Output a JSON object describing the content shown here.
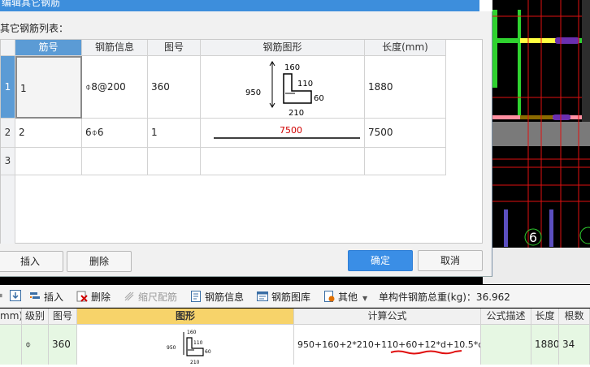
{
  "dialog": {
    "title": "编辑其它钢筋",
    "list_label": "其它钢筋列表：",
    "columns": [
      "筋号",
      "钢筋信息",
      "图号",
      "钢筋图形",
      "长度(mm)"
    ],
    "rows": [
      {
        "index": "1",
        "bar_no": "1",
        "info": "⌽8@200",
        "fig_no": "360",
        "length": "1880",
        "shape": {
          "top": "160",
          "height": "950",
          "inner": "110",
          "right": "60",
          "bottom": "210"
        }
      },
      {
        "index": "2",
        "bar_no": "2",
        "info": "6⌽6",
        "fig_no": "1",
        "length": "7500",
        "shape": {
          "span": "7500"
        }
      },
      {
        "index": "3",
        "bar_no": "",
        "info": "",
        "fig_no": "",
        "length": ""
      }
    ],
    "buttons": {
      "insert": "插入",
      "delete": "删除",
      "ok": "确定",
      "cancel": "取消"
    }
  },
  "toolbar": {
    "insert": "插入",
    "delete": "删除",
    "scale": "缩尺配筋",
    "info": "钢筋信息",
    "library": "钢筋图库",
    "other": "其他",
    "total": "单构件钢筋总重(kg)：36.962"
  },
  "bottom_table": {
    "headers": [
      "mm)",
      "级别",
      "图号",
      "图形",
      "计算公式",
      "公式描述",
      "长度",
      "根数"
    ],
    "row": {
      "level": "⌽",
      "fig_no": "360",
      "formula": "950+160+2*210+110+60+12*d+10.5*d",
      "desc": "",
      "length": "1880",
      "count": "34",
      "shape": {
        "top": "160",
        "height": "950",
        "inner": "110",
        "right": "60",
        "bottom": "210"
      }
    }
  },
  "canvas": {
    "marker": "6"
  },
  "colors": {
    "accent": "#3a8ee6",
    "selected_row_header": "#5b9bd5",
    "bottom_row": "#e6f7e3",
    "cad_red": "#e01010",
    "cad_green": "#2fd22f",
    "cad_yellow": "#ffff40",
    "cad_purple": "#6a2fb0"
  }
}
